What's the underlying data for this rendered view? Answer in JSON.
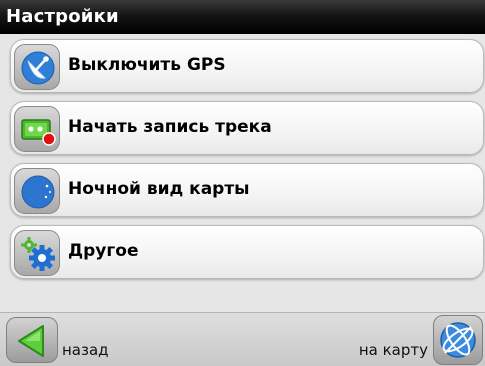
{
  "header": {
    "title": "Настройки"
  },
  "menu": {
    "items": [
      {
        "label": "Выключить GPS",
        "icon": "satellite-dish-icon"
      },
      {
        "label": "Начать запись трека",
        "icon": "record-track-icon"
      },
      {
        "label": "Ночной вид карты",
        "icon": "moon-icon"
      },
      {
        "label": "Другое",
        "icon": "gears-icon"
      }
    ]
  },
  "footer": {
    "back_label": "назад",
    "map_label": "на карту",
    "back_icon": "back-arrow-icon",
    "map_icon": "globe-icon"
  },
  "colors": {
    "title_bar": "#000000",
    "accent_blue": "#1e6fd1",
    "accent_green": "#4cb82e",
    "record_red": "#e01010"
  }
}
